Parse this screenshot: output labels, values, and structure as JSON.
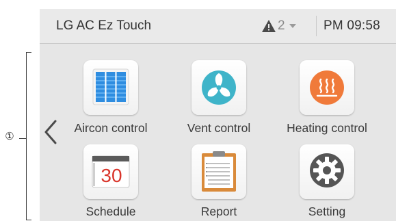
{
  "annotation": {
    "marker": "①"
  },
  "header": {
    "title": "LG AC Ez Touch",
    "alert_count": "2",
    "time": "PM 09:58"
  },
  "menu": {
    "items": [
      {
        "label": "Aircon control",
        "icon": "aircon-icon"
      },
      {
        "label": "Vent control",
        "icon": "vent-fan-icon"
      },
      {
        "label": "Heating control",
        "icon": "heating-icon"
      },
      {
        "label": "Schedule",
        "icon": "calendar-icon"
      },
      {
        "label": "Report",
        "icon": "clipboard-icon"
      },
      {
        "label": "Setting",
        "icon": "gear-icon"
      }
    ],
    "calendar_day": "30"
  },
  "colors": {
    "vent_teal": "#3fb4c9",
    "heating_orange": "#f07a3a",
    "aircon_blue": "#2f8de0",
    "calendar_red": "#d9352b"
  }
}
